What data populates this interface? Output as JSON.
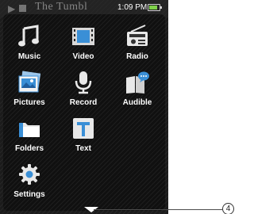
{
  "header": {
    "ghost_title": "The Tumbl",
    "time": "1:09 PM"
  },
  "menu": {
    "items": [
      {
        "label": "Music",
        "icon": "music-note-icon"
      },
      {
        "label": "Video",
        "icon": "film-icon"
      },
      {
        "label": "Radio",
        "icon": "radio-icon"
      },
      {
        "label": "Pictures",
        "icon": "pictures-icon"
      },
      {
        "label": "Record",
        "icon": "microphone-icon"
      },
      {
        "label": "Audible",
        "icon": "audible-book-icon"
      },
      {
        "label": "Folders",
        "icon": "folder-icon"
      },
      {
        "label": "Text",
        "icon": "text-icon"
      },
      {
        "label": "Settings",
        "icon": "gear-icon"
      }
    ]
  },
  "callout": {
    "number": "4"
  },
  "colors": {
    "background": "#101010",
    "icon_light": "#e8e8e8",
    "icon_blue": "#3a8fd6",
    "battery": "#7fd24a"
  }
}
